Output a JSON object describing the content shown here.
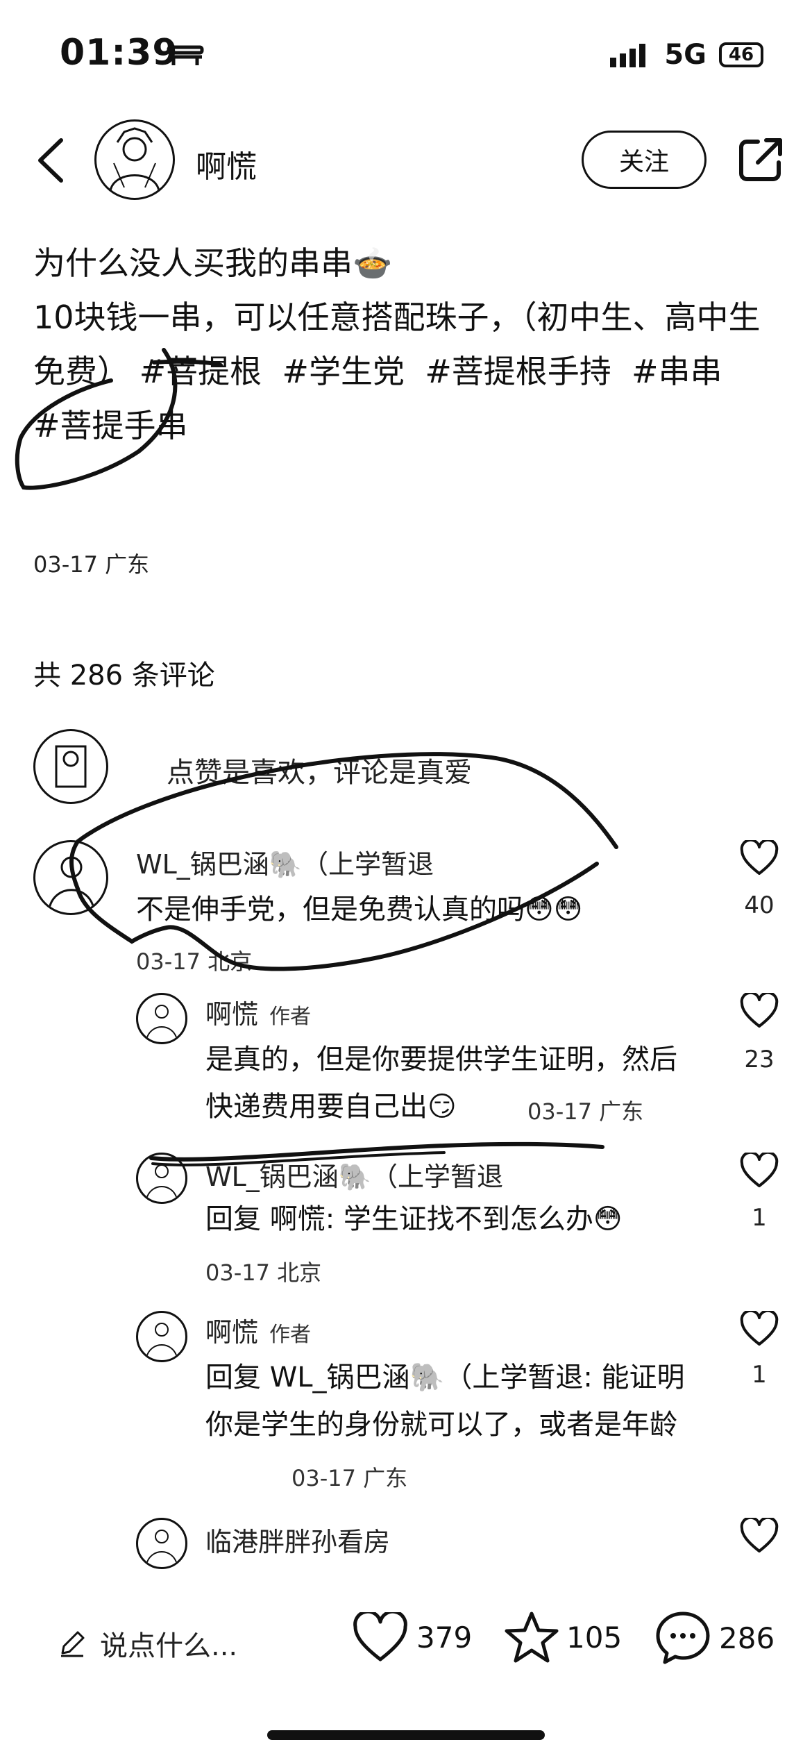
{
  "status_bar": {
    "time": "01:39",
    "network": "5G",
    "battery": "46"
  },
  "header": {
    "username": "啊慌",
    "follow_label": "关注"
  },
  "post": {
    "text": "为什么没人买我的串串🍲\n10块钱一串，可以任意搭配珠子，（初中生、高中生\n免费） #菩提根  #学生党  #菩提根手持  #串串\n#菩提手串",
    "meta": "03-17 广东"
  },
  "comments_section": {
    "count_label": "共 286 条评论",
    "pinned_hint": "点赞是喜欢，评论是真爱",
    "comments": [
      {
        "name": "WL_锅巴涵🐘（上学暂退",
        "text": "不是伸手党，但是免费认真的吗😳😳",
        "meta": "03-17 北京",
        "likes": "40"
      }
    ],
    "replies": [
      {
        "name": "啊慌",
        "author_tag": "作者",
        "text": "是真的，但是你要提供学生证明，然后快递费用要自己出😏",
        "meta": "03-17 广东",
        "likes": "23"
      },
      {
        "name": "WL_锅巴涵🐘（上学暂退",
        "text": "回复 啊慌: 学生证找不到怎么办😳",
        "meta": "03-17 北京",
        "likes": "1"
      },
      {
        "name": "啊慌",
        "author_tag": "作者",
        "text": "回复 WL_锅巴涵🐘（上学暂退: 能证明你是学生的身份就可以了，或者是年龄",
        "meta": "03-17 广东",
        "likes": "1"
      },
      {
        "name": "临港胖胖孙看房",
        "likes": ""
      }
    ]
  },
  "bottom_bar": {
    "say_placeholder": "说点什么...",
    "likes": "379",
    "favorites": "105",
    "comments": "286"
  }
}
